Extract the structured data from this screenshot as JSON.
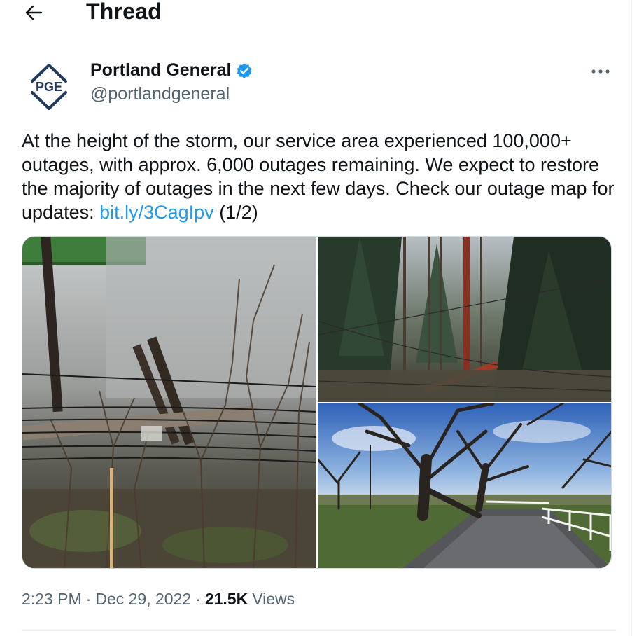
{
  "header": {
    "title": "Thread",
    "back_icon": "arrow-left-icon"
  },
  "tweet": {
    "author": {
      "name": "Portland General",
      "handle": "@portlandgeneral",
      "avatar_text": "PGE",
      "verified": true,
      "verified_color": "#1d9bf0"
    },
    "text_before_link": "At the height of the storm, our service area experienced 100,000+ outages, with approx. 6,000 outages remaining. We expect to restore the majority of outages in the next few days. Check our outage map for updates: ",
    "link_text": "bit.ly/3CagIpv",
    "text_after_link": " (1/2)",
    "link_color": "#1d9bf0",
    "media": [
      {
        "icon": "photo-downed-power-poles"
      },
      {
        "icon": "photo-forest-power-pole"
      },
      {
        "icon": "photo-fallen-oak-tree"
      }
    ],
    "meta": {
      "time": "2:23 PM",
      "separator": "·",
      "date": "Dec 29, 2022",
      "views_count": "21.5K",
      "views_label": "Views"
    }
  }
}
